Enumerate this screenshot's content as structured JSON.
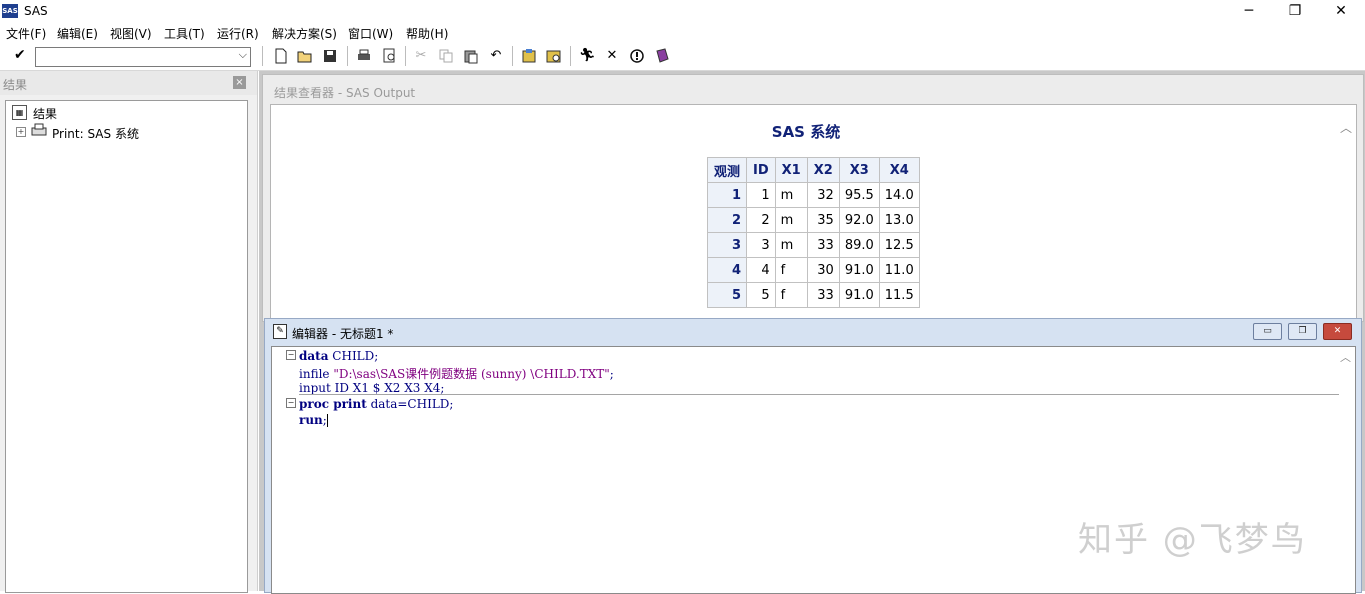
{
  "window": {
    "app_icon_text": "SAS",
    "title": "SAS",
    "minimize_glyph": "─",
    "restore_glyph": "❐",
    "close_glyph": "✕"
  },
  "menu": [
    "文件(F)",
    "编辑(E)",
    "视图(V)",
    "工具(T)",
    "运行(R)",
    "解决方案(S)",
    "窗口(W)",
    "帮助(H)"
  ],
  "toolbar": {
    "command_value": "",
    "check_glyph": "✔",
    "dropdown_glyph": "⌵",
    "icons": [
      "new-icon",
      "open-icon",
      "save-icon",
      "print-icon",
      "print-preview-icon",
      "cut-icon",
      "copy-icon",
      "paste-icon",
      "undo-icon",
      "libraries-icon",
      "explorer-icon",
      "submit-icon",
      "clear-icon",
      "break-icon",
      "help-book-icon"
    ]
  },
  "results_pane": {
    "title": "结果",
    "close_glyph": "×",
    "tree": {
      "root_label": "结果",
      "expand_glyph": "+",
      "item_label": "Print:  SAS 系统"
    }
  },
  "output_viewer": {
    "title": "结果查看器 - SAS Output",
    "report_title": "SAS 系统",
    "scroll_glyph": "︿",
    "table": {
      "columns": [
        "观测",
        "ID",
        "X1",
        "X2",
        "X3",
        "X4"
      ],
      "rows": [
        [
          "1",
          "1",
          "m",
          "32",
          "95.5",
          "14.0"
        ],
        [
          "2",
          "2",
          "m",
          "35",
          "92.0",
          "13.0"
        ],
        [
          "3",
          "3",
          "m",
          "33",
          "89.0",
          "12.5"
        ],
        [
          "4",
          "4",
          "f",
          "30",
          "91.0",
          "11.0"
        ],
        [
          "5",
          "5",
          "f",
          "33",
          "91.0",
          "11.5"
        ]
      ]
    }
  },
  "editor": {
    "title": "编辑器 - 无标题1 *",
    "btn_minimize": "▭",
    "btn_restore": "❐",
    "btn_close": "✕",
    "fold_glyph": "−",
    "scroll_glyph": "︿",
    "code": {
      "line1_kw": "data",
      "line1_rest": " CHILD;",
      "line2_pre": "infile ",
      "line2_str": "\"D:\\sas\\SAS课件例题数据 (sunny) \\CHILD.TXT\"",
      "line2_post": ";",
      "line3": "input ID X1 $ X2 X3 X4;",
      "line4_kw1": "proc print",
      "line4_rest": " data=CHILD;",
      "line5_kw": "run",
      "line5_rest": ";"
    }
  },
  "watermark": "知乎 @飞梦鸟"
}
